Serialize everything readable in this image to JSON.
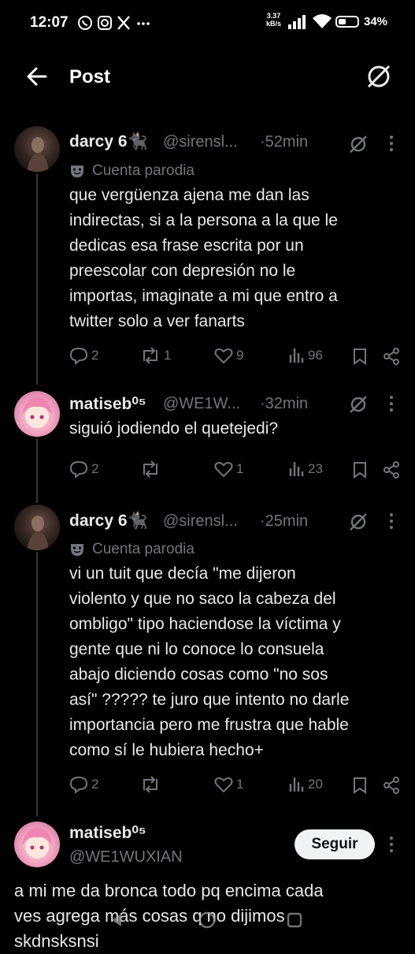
{
  "status_bar": {
    "time": "12:07",
    "app_icons": "© ⊙ X ···",
    "net_speed_value": "3.37",
    "net_speed_unit": "kB/s",
    "battery": "34%"
  },
  "header": {
    "title": "Post"
  },
  "tweets": [
    {
      "name": "darcy 6🐈‍⬛",
      "handle": "@sirensl...",
      "time": "·52min",
      "parody": "Cuenta parodia",
      "lines": [
        "que vergüenza ajena me dan las",
        "indirectas, si a la persona a la que le",
        "dedicas esa frase escrita por un",
        "preescolar con depresión no le",
        "importas, imaginate a mi que entro a",
        "twitter solo a ver fanarts"
      ],
      "replies": "2",
      "reposts": "1",
      "likes": "9",
      "views": "96"
    },
    {
      "name": "matiseb⁰⁵",
      "handle": "@WE1W...",
      "time": "·32min",
      "lines": [
        "siguió jodiendo el quetejedi?"
      ],
      "replies": "2",
      "reposts": "",
      "likes": "1",
      "views": "23"
    },
    {
      "name": "darcy 6🐈‍⬛",
      "handle": "@sirensl...",
      "time": "·25min",
      "parody": "Cuenta parodia",
      "lines": [
        "vi un tuit que decía \"me dijeron",
        "violento y que no saco la cabeza del",
        "ombligo\" tipo haciendose la víctima y",
        "gente que ni lo conoce lo consuela",
        "abajo diciendo cosas como \"no sos",
        "así\" ????? te juro que intento no darle",
        "importancia pero me frustra que hable",
        "como sí le hubiera hecho+"
      ],
      "replies": "2",
      "reposts": "",
      "likes": "1",
      "views": "20"
    }
  ],
  "main_post": {
    "name": "matiseb⁰⁵",
    "handle": "@WE1WUXIAN",
    "follow_label": "Seguir",
    "lines": [
      "a mi me da bronca todo pq encima cada",
      "ves agrega más cosas q no dijimos",
      "skdnsksnsi"
    ]
  }
}
